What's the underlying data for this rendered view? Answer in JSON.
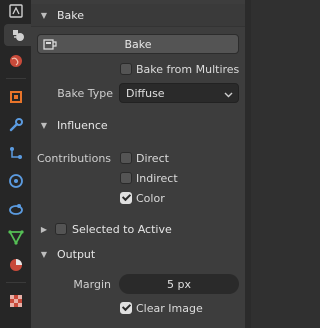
{
  "sidebar": {
    "icons": [
      "tool-icon",
      "render-icon",
      "world-icon",
      "object-icon",
      "modifier-icon",
      "particles-icon",
      "physics-icon",
      "constraints-icon",
      "data-icon",
      "material-icon",
      "texture-icon"
    ],
    "active": "render-icon"
  },
  "bake_panel": {
    "title": "Bake",
    "bake_button": "Bake",
    "bake_from_multires": {
      "label": "Bake from Multires",
      "checked": false
    },
    "bake_type": {
      "label": "Bake Type",
      "value": "Diffuse"
    }
  },
  "influence": {
    "title": "Influence",
    "contributions_label": "Contributions",
    "direct": {
      "label": "Direct",
      "checked": false
    },
    "indirect": {
      "label": "Indirect",
      "checked": false
    },
    "color": {
      "label": "Color",
      "checked": true
    }
  },
  "selected_to_active": {
    "label": "Selected to Active",
    "checked": false
  },
  "output": {
    "title": "Output",
    "margin_label": "Margin",
    "margin_value": "5 px",
    "clear_image": {
      "label": "Clear Image",
      "checked": true
    }
  },
  "colors": {
    "accent_orange": "#e8742a",
    "panel_bg": "#3d3d3d"
  }
}
